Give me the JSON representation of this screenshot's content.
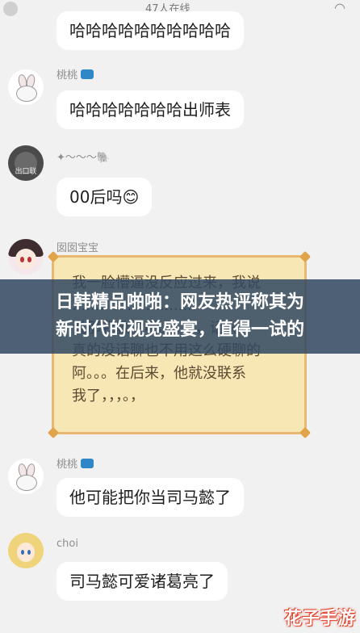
{
  "status_bar": {
    "online_text": "47人在线",
    "left_icon": "status-left-icon",
    "right_icon": "wifi-icon"
  },
  "messages": [
    {
      "name": "",
      "text": "哈哈哈哈哈哈哈哈哈哈"
    },
    {
      "name": "桃桃",
      "text": "哈哈哈哈哈哈哈出师表"
    },
    {
      "name": "✦～～～🐘",
      "text": "00后吗😊"
    },
    {
      "name": "囡囡宝宝",
      "text": ""
    },
    {
      "name": "桃桃",
      "text": "他可能把你当司马懿了"
    },
    {
      "name": "choi",
      "text": "司马懿可爱诸葛亮了"
    }
  ],
  "note": {
    "text": "我一脸懵逼没反应过来，我说\n...........................\n说那我教你吧。，。，。，话说\n真的没话聊也不用这么硬聊的\n阿。。。在后来，他就没联系\n我了，，，。，"
  },
  "overlay": {
    "line1": "日韩精品啪啪：网友热评称其为",
    "line2": "新时代的视觉盛宴，值得一试的"
  },
  "watermark": "花子手游",
  "colors": {
    "bubble": "#ffffff",
    "note_bg": "#f6e7b5",
    "note_border": "#e8b873",
    "overlay": "#324862"
  }
}
